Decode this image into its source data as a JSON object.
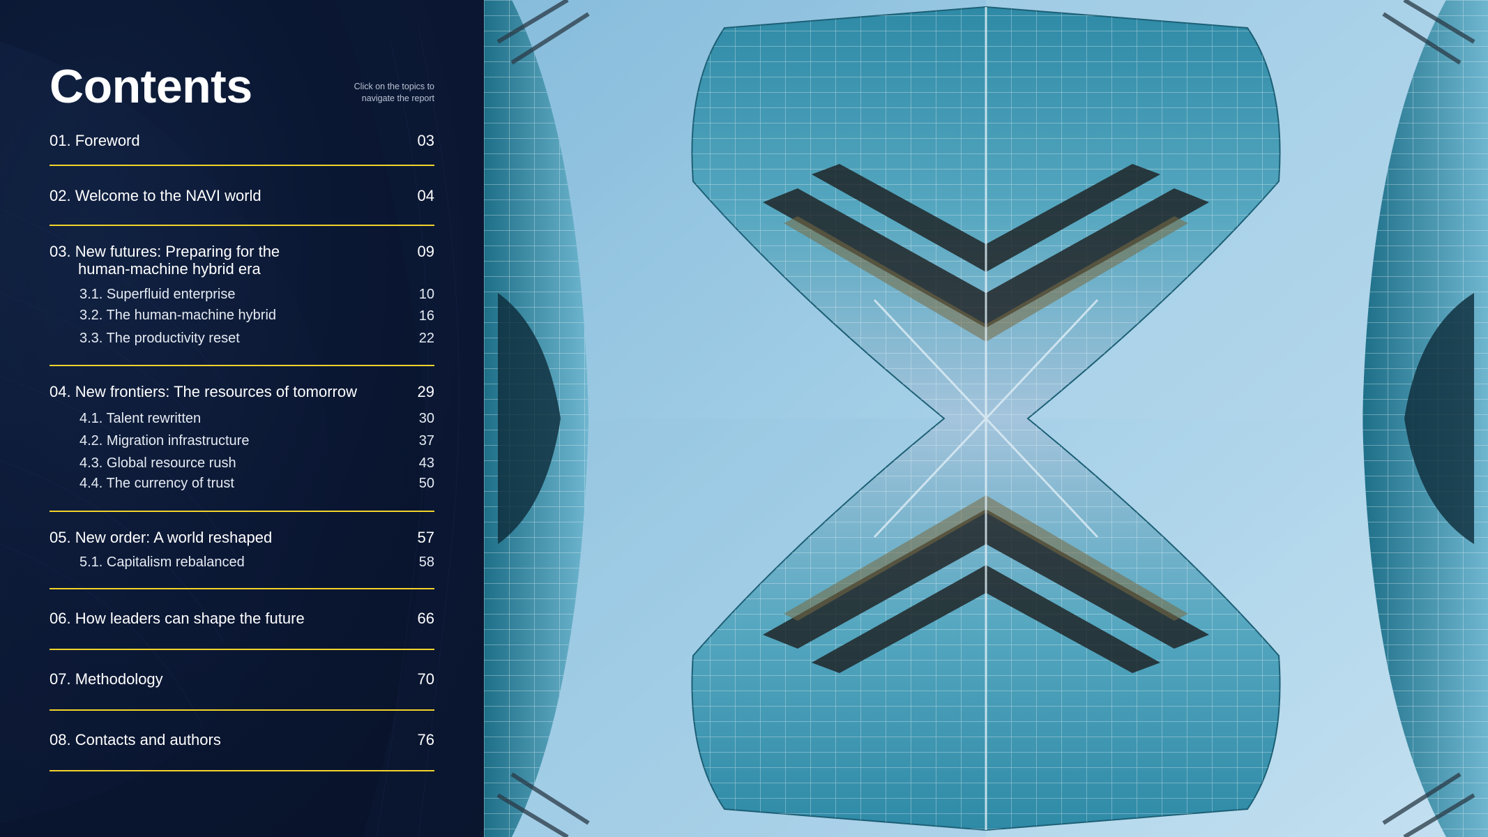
{
  "title": "Contents",
  "hint": "Click on the topics to navigate the report",
  "sections": [
    {
      "title": "01. Foreword",
      "page": "03"
    },
    {
      "title": "02. Welcome to the NAVI world",
      "page": "04"
    },
    {
      "title_line1": "03. New futures: Preparing for the",
      "title_line2": "human-machine hybrid era",
      "page": "09",
      "subs": [
        {
          "title": "3.1. Superfluid enterprise",
          "page": "10"
        },
        {
          "title": "3.2. The human-machine hybrid",
          "page": "16"
        },
        {
          "title": "3.3. The productivity reset",
          "page": "22"
        }
      ]
    },
    {
      "title": "04. New frontiers: The resources of tomorrow",
      "page": "29",
      "subs": [
        {
          "title": "4.1. Talent rewritten",
          "page": "30"
        },
        {
          "title": "4.2. Migration infrastructure",
          "page": "37"
        },
        {
          "title": "4.3. Global resource rush",
          "page": "43"
        },
        {
          "title": "4.4. The currency of trust",
          "page": "50"
        }
      ]
    },
    {
      "title": "05. New order: A world reshaped",
      "page": "57",
      "subs": [
        {
          "title": "5.1. Capitalism rebalanced",
          "page": "58"
        }
      ]
    },
    {
      "title": "06. How leaders can shape the future",
      "page": "66"
    },
    {
      "title": "07. Methodology",
      "page": "70"
    },
    {
      "title": "08. Contacts and authors",
      "page": "76"
    }
  ],
  "colors": {
    "panel_background": "#0a1733",
    "rule_accent": "#f2d32a",
    "sky": "#9ccbe4",
    "glass_teal": "#3a93ad"
  }
}
